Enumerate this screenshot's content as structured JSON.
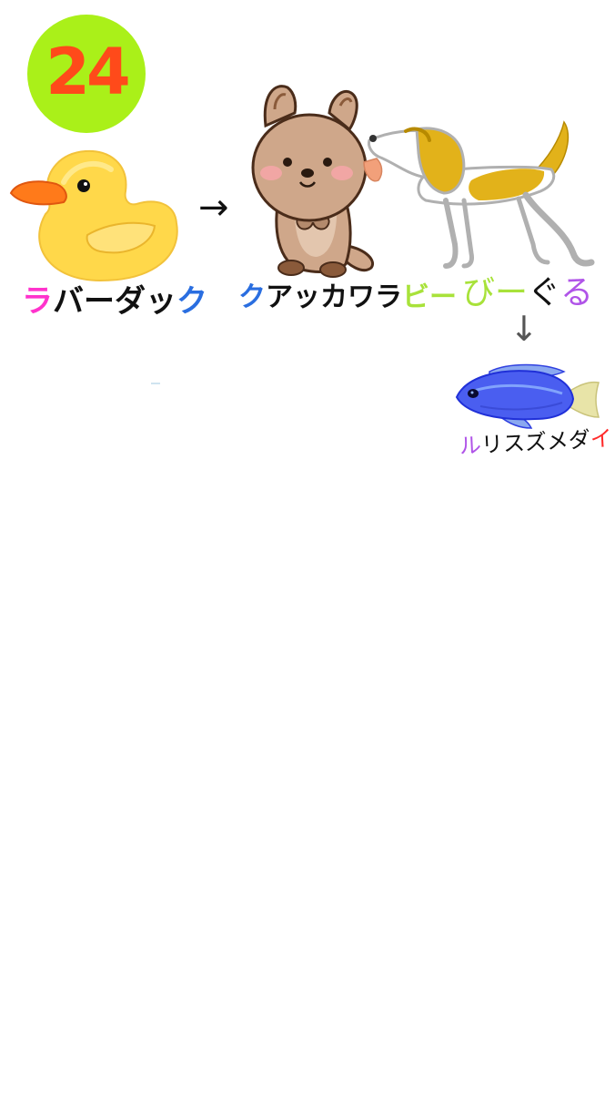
{
  "badge": {
    "number": "24",
    "fill": "#aaf019",
    "text_color": "#ff4a1a"
  },
  "words": [
    {
      "id": "rubber-duck",
      "parts": [
        {
          "text": "ラ",
          "color": "#ff33cc"
        },
        {
          "text": "バーダッ",
          "color": "#111111"
        },
        {
          "text": "ク",
          "color": "#2a6ee0"
        }
      ]
    },
    {
      "id": "quokka-wallaby",
      "parts": [
        {
          "text": "ク",
          "color": "#2a6ee0"
        },
        {
          "text": "アッカワラ",
          "color": "#111111"
        },
        {
          "text": "ビー",
          "color": "#a8e23a"
        }
      ]
    },
    {
      "id": "beagle",
      "parts": [
        {
          "text": "びー",
          "color": "#a8e23a"
        },
        {
          "text": "ぐ",
          "color": "#111111"
        },
        {
          "text": "る",
          "color": "#b054e8"
        }
      ]
    },
    {
      "id": "blue-damselfish",
      "parts": [
        {
          "text": "ル",
          "color": "#b054e8"
        },
        {
          "text": "リスズメダ",
          "color": "#111111"
        },
        {
          "text": "イ",
          "color": "#ff2a2a"
        }
      ]
    }
  ],
  "arrows": {
    "right": "→",
    "down": "↓"
  },
  "icons": [
    "rubber-duck-icon",
    "quokka-icon",
    "beagle-icon",
    "damselfish-icon"
  ]
}
